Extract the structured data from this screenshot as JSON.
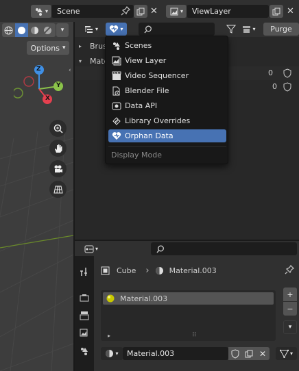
{
  "top": {
    "scene_label": "Scene",
    "viewlayer_label": "ViewLayer"
  },
  "viewport": {
    "options_label": "Options",
    "axis_x": "X",
    "axis_y": "Y",
    "axis_z": "Z"
  },
  "outliner": {
    "purge_label": "Purge",
    "tree": [
      {
        "label": "Brus",
        "expanded": false
      },
      {
        "label": "Mate",
        "expanded": true
      }
    ],
    "user_counts": [
      "0",
      "0"
    ]
  },
  "display_mode_menu": {
    "items": [
      {
        "label": "Scenes",
        "icon": "scenes-icon",
        "active": false
      },
      {
        "label": "View Layer",
        "icon": "view-layer-icon",
        "active": false
      },
      {
        "label": "Video Sequencer",
        "icon": "video-sequencer-icon",
        "active": false
      },
      {
        "label": "Blender File",
        "icon": "blender-file-icon",
        "active": false
      },
      {
        "label": "Data API",
        "icon": "data-api-icon",
        "active": false
      },
      {
        "label": "Library Overrides",
        "icon": "library-overrides-icon",
        "active": false
      },
      {
        "label": "Orphan Data",
        "icon": "orphan-data-icon",
        "active": true
      }
    ],
    "footer": "Display Mode"
  },
  "properties": {
    "breadcrumb_object": "Cube",
    "breadcrumb_material": "Material.003",
    "slot_name": "Material.003",
    "material_field": "Material.003"
  },
  "colors": {
    "accent": "#4772b3",
    "axis_x": "#e5404f",
    "axis_y": "#8bc34a",
    "axis_z": "#3f8fe5"
  }
}
